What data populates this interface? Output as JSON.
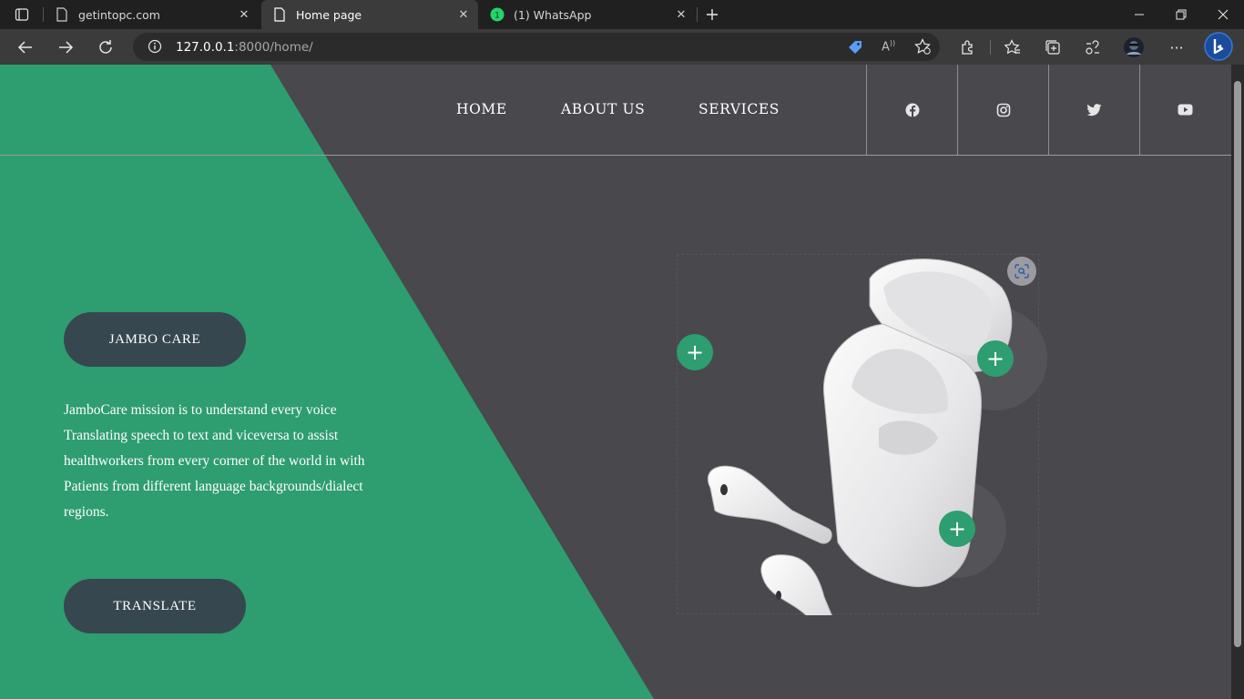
{
  "browser": {
    "tabs": [
      {
        "title": "getintopc.com",
        "icon": "page-icon"
      },
      {
        "title": "Home page",
        "icon": "page-icon"
      },
      {
        "title": "(1) WhatsApp",
        "icon": "whatsapp-icon",
        "badge": "1"
      }
    ],
    "address": {
      "host": "127.0.0.1",
      "path": ":8000/home/"
    }
  },
  "nav": {
    "items": [
      "HOME",
      "ABOUT US",
      "SERVICES"
    ],
    "social": [
      "facebook-icon",
      "instagram-icon",
      "twitter-icon",
      "youtube-icon"
    ]
  },
  "hero": {
    "brand_button": "JAMBO CARE",
    "mission": "JamboCare mission is to understand every voice Translating speech to text and viceversa to assist healthworkers from every corner of the world in with Patients from different language backgrounds/dialect regions.",
    "translate_button": "TRANSLATE",
    "plus_symbol": "+"
  },
  "colors": {
    "accent_green": "#2e9d70",
    "page_bg": "#48484d",
    "pill_bg": "#37474f"
  }
}
